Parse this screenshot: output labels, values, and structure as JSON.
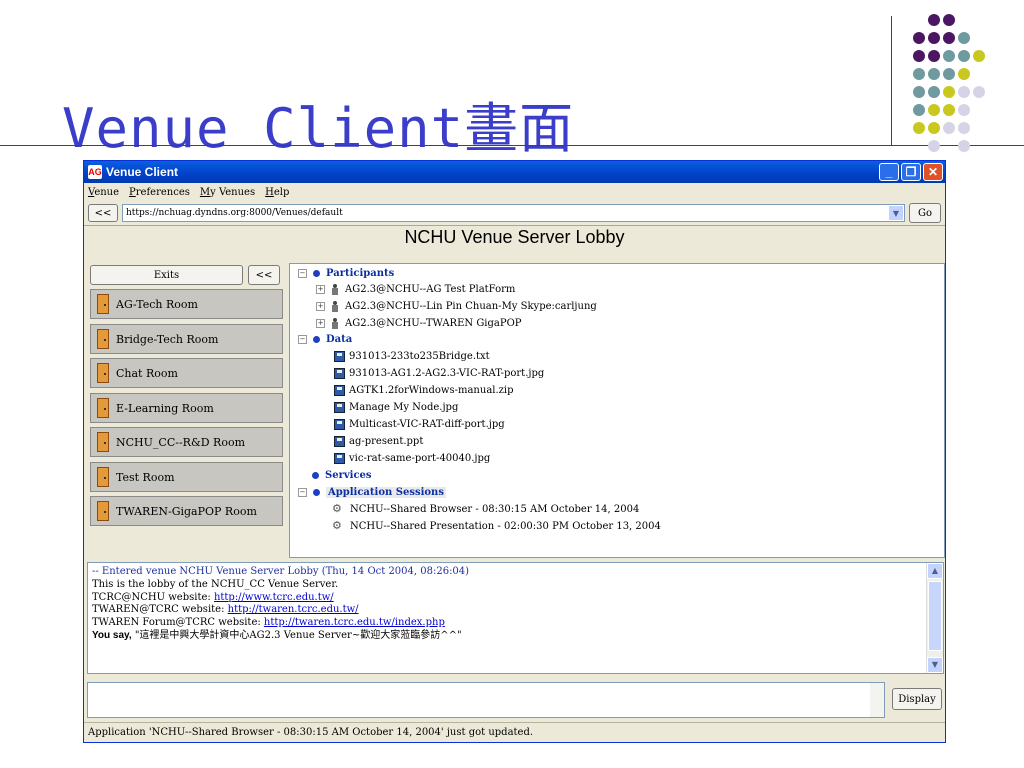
{
  "slide": {
    "title": "Venue Client畫面"
  },
  "colors": {
    "accent_purple": "#4b1763",
    "accent_teal": "#6e9aa0",
    "accent_lime": "#c8c81e",
    "accent_lavender": "#d4d4e6",
    "title_blue": "#3a3ec8"
  },
  "window": {
    "app_icon": "AG",
    "title": "Venue Client",
    "controls": {
      "minimize": "_",
      "maximize": "❐",
      "close": "✕"
    }
  },
  "menu": [
    "Venue",
    "Preferences",
    "My Venues",
    "Help"
  ],
  "urlbar": {
    "back_label": "<<",
    "url": "https://nchuag.dyndns.org:8000/Venues/default",
    "go_label": "Go"
  },
  "venue_title": "NCHU Venue Server Lobby",
  "exits": {
    "exits_label": "Exits",
    "collapse_label": "<<",
    "items": [
      "AG-Tech Room",
      "Bridge-Tech Room",
      "Chat Room",
      "E-Learning Room",
      "NCHU_CC--R&D Room",
      "Test Room",
      "TWAREN-GigaPOP Room"
    ]
  },
  "tree": {
    "participants_label": "Participants",
    "participants": [
      "AG2.3@NCHU--AG Test PlatForm",
      "AG2.3@NCHU--Lin Pin Chuan-My Skype:carljung",
      "AG2.3@NCHU--TWAREN GigaPOP"
    ],
    "data_label": "Data",
    "data": [
      "931013-233to235Bridge.txt",
      "931013-AG1.2-AG2.3-VIC-RAT-port.jpg",
      "AGTK1.2forWindows-manual.zip",
      "Manage My Node.jpg",
      "Multicast-VIC-RAT-diff-port.jpg",
      "ag-present.ppt",
      "vic-rat-same-port-40040.jpg"
    ],
    "services_label": "Services",
    "apps_label": "Application Sessions",
    "apps": [
      "NCHU--Shared Browser - 08:30:15 AM October 14, 2004",
      "NCHU--Shared Presentation - 02:00:30 PM October 13, 2004"
    ]
  },
  "chat": {
    "entered": "-- Entered venue NCHU Venue Server Lobby (Thu, 14 Oct 2004, 08:26:04)",
    "lines": [
      {
        "prefix": "This is the lobby of the NCHU_CC Venue Server.",
        "link": ""
      },
      {
        "prefix": "TCRC@NCHU website: ",
        "link": "http://www.tcrc.edu.tw/"
      },
      {
        "prefix": "TWAREN@TCRC website: ",
        "link": "http://twaren.tcrc.edu.tw/"
      },
      {
        "prefix": "TWAREN Forum@TCRC website: ",
        "link": "http://twaren.tcrc.edu.tw/index.php"
      }
    ],
    "you_say_label": "You say,",
    "you_say_text": " \"這裡是中興大學計資中心AG2.3 Venue Server~歡迎大家蒞臨參訪^^\""
  },
  "input": {
    "display_label": "Display"
  },
  "status": "Application 'NCHU--Shared Browser - 08:30:15 AM October 14, 2004' just got updated."
}
